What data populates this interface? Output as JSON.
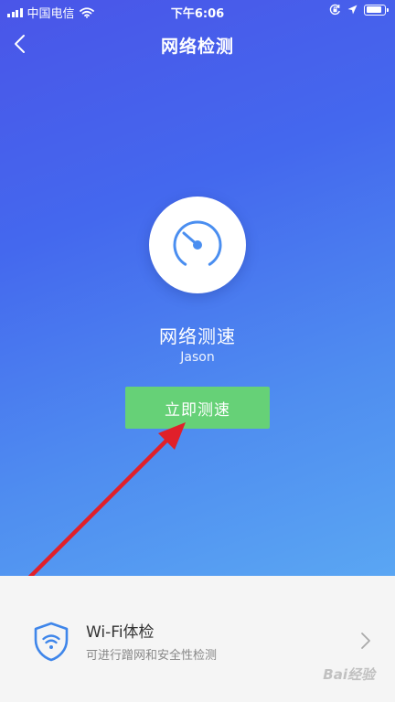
{
  "status_bar": {
    "carrier": "中国电信",
    "time": "下午6:06",
    "icons": [
      "signal-icon",
      "wifi-icon",
      "orientation-lock-icon",
      "location-icon",
      "battery-icon"
    ],
    "battery_level": 0.85
  },
  "nav": {
    "back_icon": "chevron-left-icon",
    "title": "网络检测"
  },
  "hero": {
    "icon": "speedometer-icon",
    "title": "网络测速",
    "subtitle": "Jason",
    "button_label": "立即测速",
    "colors": {
      "gradient_top": "#4a55e8",
      "gradient_bottom": "#5aa6f3",
      "button": "#66d177",
      "gauge": "#4a8ef0",
      "annotation_arrow": "#e0202a"
    }
  },
  "list": {
    "items": [
      {
        "icon": "wifi-shield-icon",
        "title": "Wi-Fi体检",
        "description": "可进行蹭网和安全性检测",
        "trailing_icon": "chevron-right-icon"
      }
    ]
  },
  "watermark": "Bai经验"
}
